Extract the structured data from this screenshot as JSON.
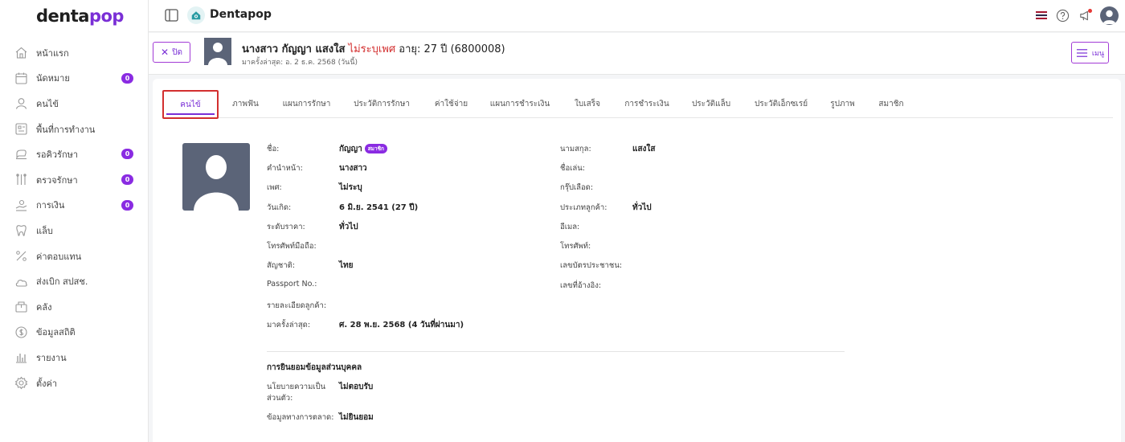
{
  "sidebar": {
    "logo_main": "denta",
    "logo_accent": "pop",
    "items": [
      {
        "label": "หน้าแรก",
        "icon": "home-icon",
        "badge": null
      },
      {
        "label": "นัดหมาย",
        "icon": "calendar-icon",
        "badge": "0"
      },
      {
        "label": "คนไข้",
        "icon": "user-icon",
        "badge": null
      },
      {
        "label": "พื้นที่การทำงาน",
        "icon": "workspace-icon",
        "badge": null
      },
      {
        "label": "รอคิวรักษา",
        "icon": "dental-chair-icon",
        "badge": "0"
      },
      {
        "label": "ตรวจรักษา",
        "icon": "dental-tools-icon",
        "badge": "0"
      },
      {
        "label": "การเงิน",
        "icon": "payment-icon",
        "badge": "0"
      },
      {
        "label": "แล็บ",
        "icon": "tooth-icon",
        "badge": null
      },
      {
        "label": "ค่าตอบแทน",
        "icon": "percent-icon",
        "badge": null
      },
      {
        "label": "ส่งเบิก สปสช.",
        "icon": "cloud-icon",
        "badge": null
      },
      {
        "label": "คลัง",
        "icon": "inventory-icon",
        "badge": null
      },
      {
        "label": "ข้อมูลสถิติ",
        "icon": "statistics-icon",
        "badge": null
      },
      {
        "label": "รายงาน",
        "icon": "report-icon",
        "badge": null
      },
      {
        "label": "ตั้งค่า",
        "icon": "settings-icon",
        "badge": null
      }
    ]
  },
  "topbar": {
    "app_title": "Dentapop",
    "flag_colors": [
      "#a51931",
      "#f4f5f8",
      "#2d2a4a",
      "#f4f5f8",
      "#a51931"
    ]
  },
  "patient_header": {
    "close_label": "ปิด",
    "name": "นางสาว กัญญา แสงใส",
    "sex": "ไม่ระบุเพศ",
    "age": "อายุ: 27 ปี",
    "patient_code": "(6800008)",
    "last_visit": "มาครั้งล่าสุด: อ. 2 ธ.ค. 2568 (วันนี้)",
    "menu_label": "เมนู"
  },
  "tabs": [
    {
      "label": "คนไข้",
      "active": true
    },
    {
      "label": "ภาพฟัน",
      "active": false
    },
    {
      "label": "แผนการรักษา",
      "active": false
    },
    {
      "label": "ประวัติการรักษา",
      "active": false
    },
    {
      "label": "ค่าใช้จ่าย",
      "active": false
    },
    {
      "label": "แผนการชำระเงิน",
      "active": false
    },
    {
      "label": "ใบเสร็จ",
      "active": false
    },
    {
      "label": "การชำระเงิน",
      "active": false
    },
    {
      "label": "ประวัติแล็บ",
      "active": false
    },
    {
      "label": "ประวัติเอ็กซเรย์",
      "active": false
    },
    {
      "label": "รูปภาพ",
      "active": false
    },
    {
      "label": "สมาชิก",
      "active": false
    }
  ],
  "details": {
    "first_name_label": "ชื่อ:",
    "first_name": "กัญญา",
    "member_badge": "สมาชิก",
    "last_name_label": "นามสกุล:",
    "last_name": "แสงใส",
    "title_label": "คำนำหน้า:",
    "title": "นางสาว",
    "nickname_label": "ชื่อเล่น:",
    "nickname": "",
    "sex_label": "เพศ:",
    "sex": "ไม่ระบุ",
    "blood_label": "กรุ๊ปเลือด:",
    "blood": "",
    "birth_label": "วันเกิด:",
    "birth": "6 มิ.ย. 2541 (27 ปี)",
    "customer_type_label": "ประเภทลูกค้า:",
    "customer_type": "ทั่วไป",
    "price_level_label": "ระดับราคา:",
    "price_level": "ทั่วไป",
    "email_label": "อีเมล:",
    "email": "",
    "mobile_label": "โทรศัพท์มือถือ:",
    "mobile": "",
    "phone_label": "โทรศัพท์:",
    "phone": "",
    "nationality_label": "สัญชาติ:",
    "nationality": "ไทย",
    "id_card_label": "เลขบัตรประชาชน:",
    "id_card": "",
    "passport_label": "Passport No.:",
    "passport": "",
    "reference_label": "เลขที่อ้างอิง:",
    "reference": "",
    "customer_detail_label": "รายละเอียดลูกค้า:",
    "customer_detail": "",
    "last_visit_label": "มาครั้งล่าสุด:",
    "last_visit": "ศ. 28 พ.ย. 2568 (4 วันที่ผ่านมา)"
  },
  "consent": {
    "section_title": "การยินยอมข้อมูลส่วนบุคคล",
    "privacy_label_line1": "นโยบายความเป็น",
    "privacy_label_line2": "ส่วนตัว:",
    "privacy_value": "ไม่ตอบรับ",
    "marketing_label": "ข้อมูลทางการตลาด:",
    "marketing_value": "ไม่ยินยอม"
  }
}
